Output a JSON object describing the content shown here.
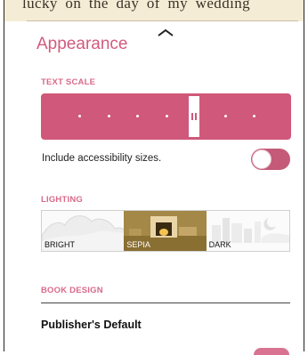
{
  "book": {
    "visible_text": "lucky on the day of my wedding"
  },
  "panel": {
    "title": "Appearance",
    "handle_icon": "chevron-up-icon"
  },
  "text_scale": {
    "label": "TEXT SCALE",
    "steps": 7,
    "selected_index": 4
  },
  "accessibility": {
    "label": "Include accessibility sizes.",
    "enabled": false
  },
  "lighting": {
    "label": "LIGHTING",
    "options": [
      {
        "label": "BRIGHT",
        "selected": false
      },
      {
        "label": "SEPIA",
        "selected": true
      },
      {
        "label": "DARK",
        "selected": false
      }
    ]
  },
  "book_design": {
    "label": "BOOK DESIGN",
    "value": "Publisher's Default"
  },
  "colors": {
    "accent": "#d0587a",
    "sepia": "#a48847",
    "book_page": "#f5ecd6"
  }
}
